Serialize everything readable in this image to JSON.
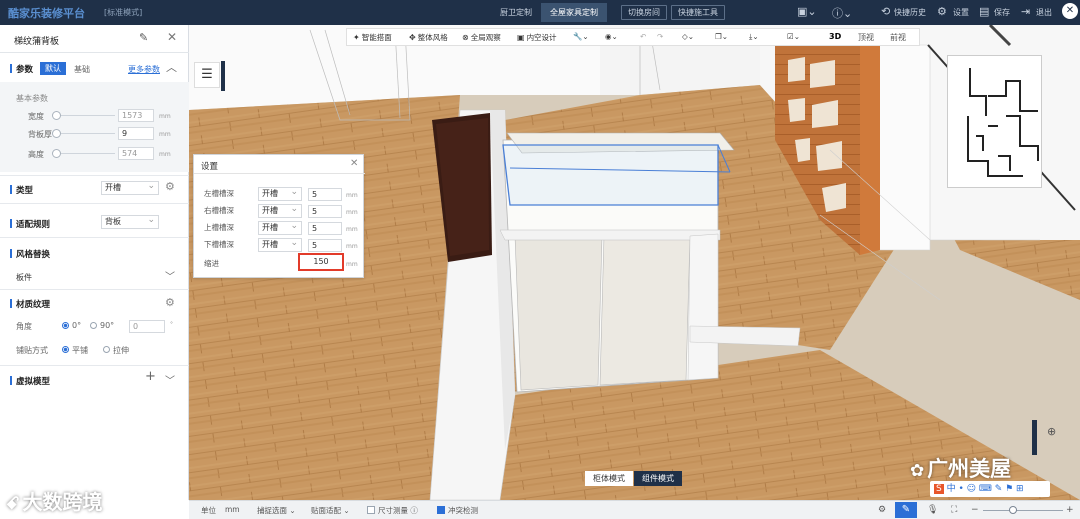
{
  "app": {
    "title": "酷家乐装修平台",
    "mode": "[标准模式]"
  },
  "top_tabs": [
    "厨卫定制",
    "全屋家具定制"
  ],
  "top_buttons": [
    "切换房间",
    "快捷施工具"
  ],
  "top_actions": {
    "history": "快捷历史",
    "settings": "设置",
    "save": "保存",
    "exit": "退出"
  },
  "left_panel": {
    "title": "梯纹蒲背板",
    "params": {
      "label": "参数",
      "tab_default": "默认",
      "tab_basic": "基础",
      "advanced": "更多参数"
    },
    "basic_params": {
      "label": "基本参数",
      "rows": [
        {
          "name": "宽度",
          "value": "1573",
          "unit": "mm"
        },
        {
          "name": "背板厚",
          "value": "9",
          "unit": "mm"
        },
        {
          "name": "高度",
          "value": "574",
          "unit": "mm"
        }
      ]
    },
    "type": {
      "label": "类型",
      "value": "开槽"
    },
    "match_rule": {
      "label": "适配规则",
      "value": "背板"
    },
    "style_replace": {
      "label": "风格替换",
      "sub": "板件"
    },
    "material": {
      "label": "材质纹理",
      "angle_label": "角度",
      "angle_options": [
        "0°",
        "90°"
      ],
      "angle_input": "0",
      "angle_unit": "°",
      "layout_label": "铺贴方式",
      "layout_options": [
        "平铺",
        "拉伸"
      ]
    },
    "virtual_model": {
      "label": "虚拟模型"
    }
  },
  "toolbar": {
    "items": [
      "智能搭面",
      "整体风格",
      "全局观察",
      "内空设计"
    ],
    "views": [
      "3D",
      "顶视",
      "前视"
    ]
  },
  "dialog": {
    "title": "设置",
    "rows": [
      {
        "label": "左槽槽深",
        "type": "开槽",
        "value": "5",
        "unit": "mm"
      },
      {
        "label": "右槽槽深",
        "type": "开槽",
        "value": "5",
        "unit": "mm"
      },
      {
        "label": "上槽槽深",
        "type": "开槽",
        "value": "5",
        "unit": "mm"
      },
      {
        "label": "下槽槽深",
        "type": "开槽",
        "value": "5",
        "unit": "mm"
      }
    ],
    "indent": {
      "label": "缩进",
      "value": "150",
      "unit": "mm"
    }
  },
  "mode_switch": {
    "cabinet": "柜体模式",
    "component": "组件模式"
  },
  "bottom_bar": {
    "unit_label": "单位",
    "unit_value": "mm",
    "snap": "捕捉选面",
    "adapt": "贴面适配",
    "dimension": "尺寸测量",
    "collision": "冲突检测"
  },
  "watermarks": {
    "left": "大数跨境",
    "right": "广州美屋"
  },
  "colors": {
    "topbar": "#1f3048",
    "accent": "#2b6fd6",
    "highlight": "#e23b2a"
  }
}
